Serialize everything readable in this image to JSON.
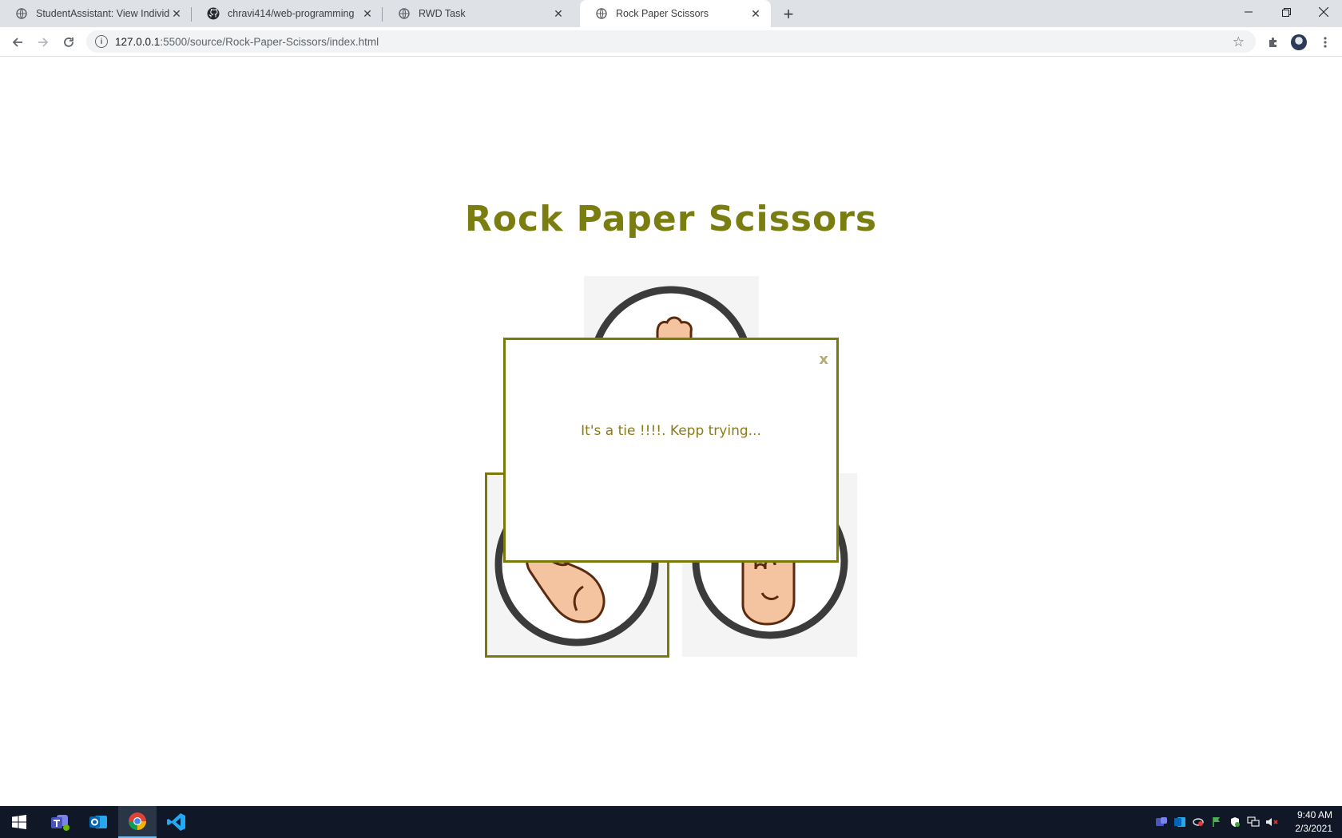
{
  "browser": {
    "tabs": [
      {
        "title": "StudentAssistant: View Individual",
        "active": false
      },
      {
        "title": "chravi414/web-programming",
        "active": false
      },
      {
        "title": "RWD Task",
        "active": false
      },
      {
        "title": "Rock Paper Scissors",
        "active": true
      }
    ],
    "url_host": "127.0.0.1",
    "url_rest": ":5500/source/Rock-Paper-Scissors/index.html"
  },
  "page": {
    "heading": "Rock Paper Scissors",
    "choices": [
      {
        "name": "paper",
        "selected": false
      },
      {
        "name": "rock",
        "selected": true
      },
      {
        "name": "scissors",
        "selected": false
      }
    ]
  },
  "modal": {
    "close_label": "x",
    "message": "It's a tie !!!!. Kepp trying..."
  },
  "taskbar": {
    "apps": [
      "start",
      "teams",
      "outlook",
      "chrome",
      "vscode"
    ],
    "active_app": "chrome",
    "time": "9:40 AM",
    "date": "2/3/2021"
  },
  "colors": {
    "accent": "#7a7d0f",
    "modal_border": "#7a7a0a",
    "skin": "#f4c4a0",
    "ring": "#3b3b3b"
  }
}
